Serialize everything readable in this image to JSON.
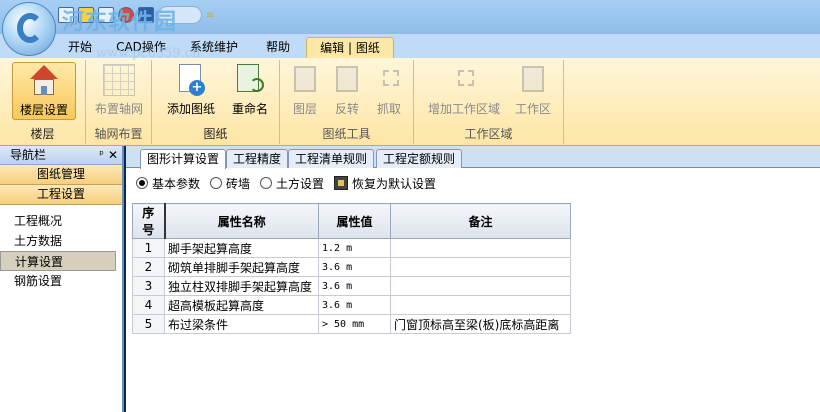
{
  "watermark": {
    "text": "河东软件园",
    "url": "www.pc0359.cn"
  },
  "menu_tabs": [
    {
      "label": "开始"
    },
    {
      "label": "CAD操作"
    },
    {
      "label": "系统维护"
    },
    {
      "label": "帮助"
    },
    {
      "label": "编辑 | 图纸"
    }
  ],
  "ribbon": {
    "groups": [
      {
        "label": "楼层",
        "buttons": [
          {
            "label": "楼层设置",
            "icon": "house-icon"
          }
        ]
      },
      {
        "label": "轴网布置",
        "buttons": [
          {
            "label": "布置轴网",
            "icon": "grid-icon"
          }
        ]
      },
      {
        "label": "图纸",
        "buttons": [
          {
            "label": "添加图纸",
            "icon": "add-document-icon"
          },
          {
            "label": "重命名",
            "icon": "rename-icon"
          }
        ]
      },
      {
        "label": "图纸工具",
        "buttons": [
          {
            "label": "图层",
            "icon": "layer-icon"
          },
          {
            "label": "反转",
            "icon": "invert-icon"
          },
          {
            "label": "抓取",
            "icon": "crop-icon"
          }
        ]
      },
      {
        "label": "工作区域",
        "buttons": [
          {
            "label": "增加工作区域",
            "icon": "add-area-icon"
          },
          {
            "label": "工作区",
            "icon": "workspace-icon"
          }
        ]
      }
    ]
  },
  "nav": {
    "title": "导航栏",
    "pin": "ᵖ",
    "close": "✕",
    "buttons": [
      "图纸管理",
      "工程设置"
    ],
    "items": [
      "工程概况",
      "土方数据",
      "计算设置",
      "钢筋设置"
    ]
  },
  "subtabs": [
    "图形计算设置",
    "工程精度",
    "工程清单规则",
    "工程定额规则"
  ],
  "options": {
    "radios": [
      "基本参数",
      "砖墙",
      "土方设置"
    ],
    "selected": "基本参数",
    "restore": "恢复为默认设置"
  },
  "table": {
    "headers": [
      "序号",
      "属性名称",
      "属性值",
      "备注"
    ],
    "rows": [
      {
        "no": "1",
        "name": "脚手架起算高度",
        "value": "1.2 m",
        "note": ""
      },
      {
        "no": "2",
        "name": "砌筑单排脚手架起算高度",
        "value": "3.6 m",
        "note": ""
      },
      {
        "no": "3",
        "name": "独立柱双排脚手架起算高度",
        "value": "3.6 m",
        "note": ""
      },
      {
        "no": "4",
        "name": "超高模板起算高度",
        "value": "3.6 m",
        "note": ""
      },
      {
        "no": "5",
        "name": "布过梁条件",
        "value": "> 50 mm",
        "note": "门窗顶标高至梁(板)底标高距离"
      }
    ]
  }
}
